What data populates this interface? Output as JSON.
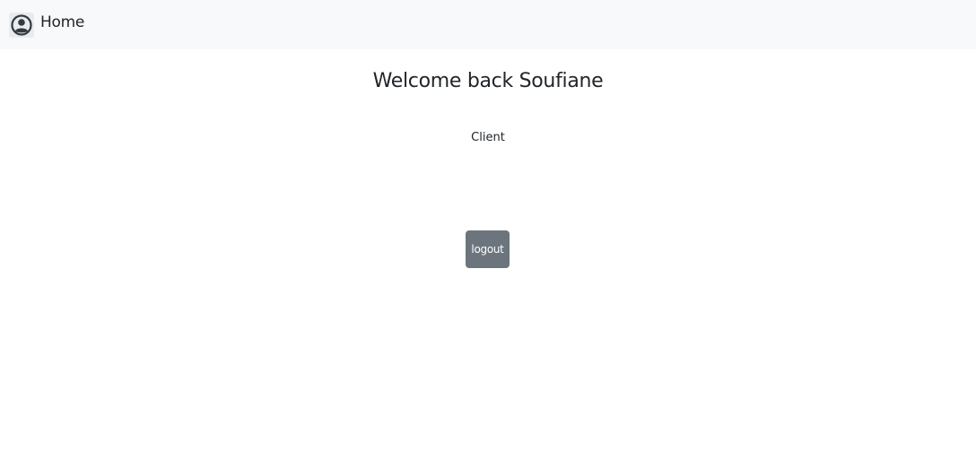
{
  "navbar": {
    "brand_label": "Home",
    "brand_icon": "user-circle-icon"
  },
  "main": {
    "welcome_title": "Welcome back Soufiane",
    "role_label": "Client",
    "logout_label": "logout"
  },
  "colors": {
    "navbar_background": "#f8f9fa",
    "button_background": "#6c757d",
    "text": "#212529"
  }
}
